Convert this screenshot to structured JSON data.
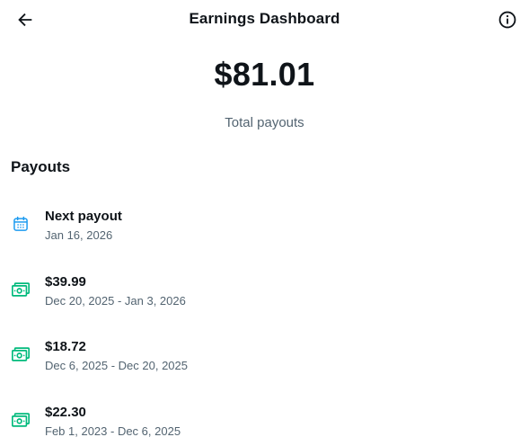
{
  "header": {
    "title": "Earnings Dashboard",
    "back_icon": "arrow-left-icon",
    "info_icon": "info-icon"
  },
  "summary": {
    "total_amount": "$81.01",
    "total_label": "Total payouts"
  },
  "payouts": {
    "section_title": "Payouts",
    "items": [
      {
        "icon": "calendar-icon",
        "title": "Next payout",
        "subtitle": "Jan 16, 2026"
      },
      {
        "icon": "money-icon",
        "title": "$39.99",
        "subtitle": "Dec 20, 2025 - Jan 3, 2026"
      },
      {
        "icon": "money-icon",
        "title": "$18.72",
        "subtitle": "Dec 6, 2025 - Dec 20, 2025"
      },
      {
        "icon": "money-icon",
        "title": "$22.30",
        "subtitle": "Feb 1, 2023 - Dec 6, 2025"
      }
    ]
  },
  "colors": {
    "text_primary": "#0f1419",
    "text_secondary": "#536471",
    "calendar_icon": "#1d9bf0",
    "money_icon": "#00ba7c"
  }
}
